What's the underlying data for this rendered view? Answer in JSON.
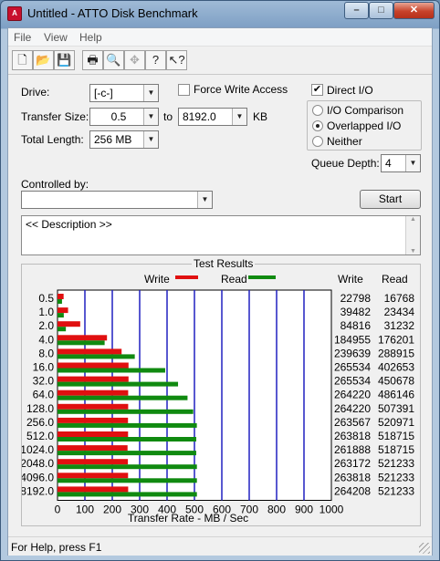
{
  "window": {
    "title": "Untitled - ATTO Disk Benchmark",
    "app_icon": "atto-logo-icon"
  },
  "menu": {
    "items": [
      "File",
      "View",
      "Help"
    ]
  },
  "toolbar": {
    "icons": [
      "new-document-icon",
      "open-folder-icon",
      "save-icon",
      "print-icon",
      "print-preview-icon",
      "move-icon",
      "help-icon",
      "context-help-icon"
    ]
  },
  "form": {
    "drive_label": "Drive:",
    "drive_value": "[-c-]",
    "force_write_label": "Force Write Access",
    "force_write_checked": false,
    "direct_io_label": "Direct I/O",
    "direct_io_checked": true,
    "transfer_size_label": "Transfer Size:",
    "transfer_from": "0.5",
    "to_label": "to",
    "transfer_to": "8192.0",
    "kb_label": "KB",
    "total_length_label": "Total Length:",
    "total_length_value": "256 MB",
    "io_comparison_label": "I/O Comparison",
    "overlapped_io_label": "Overlapped I/O",
    "neither_label": "Neither",
    "io_mode_selected": "Overlapped I/O",
    "queue_depth_label": "Queue Depth:",
    "queue_depth_value": "4",
    "controlled_by_label": "Controlled by:",
    "controlled_by_value": "",
    "start_label": "Start",
    "description": "<< Description >>"
  },
  "results": {
    "title": "Test Results",
    "legend_write": "Write",
    "legend_read": "Read",
    "col_write": "Write",
    "col_read": "Read",
    "xlabel": "Transfer Rate - MB / Sec"
  },
  "colors": {
    "write": "#e01010",
    "read": "#108a10",
    "grid": "#2020c0"
  },
  "chart_data": {
    "type": "bar",
    "title": "Test Results",
    "xlabel": "Transfer Rate - MB / Sec",
    "categories": [
      "0.5",
      "1.0",
      "2.0",
      "4.0",
      "8.0",
      "16.0",
      "32.0",
      "64.0",
      "128.0",
      "256.0",
      "512.0",
      "1024.0",
      "2048.0",
      "4096.0",
      "8192.0"
    ],
    "series": [
      {
        "name": "Write",
        "values": [
          22798,
          39482,
          84816,
          184955,
          239639,
          265534,
          265534,
          264220,
          264220,
          263567,
          263818,
          261888,
          263172,
          263818,
          264208
        ]
      },
      {
        "name": "Read",
        "values": [
          16768,
          23434,
          31232,
          176201,
          288915,
          402653,
          450678,
          486146,
          507391,
          520971,
          518715,
          518715,
          521233,
          521233,
          521233
        ]
      }
    ],
    "xlim": [
      0,
      1000
    ],
    "xticks": [
      "0",
      "100",
      "200",
      "300",
      "400",
      "500",
      "600",
      "700",
      "800",
      "900",
      "1000"
    ],
    "orientation": "horizontal",
    "legend": "top",
    "grid": true
  },
  "status": {
    "text": "For Help, press F1"
  }
}
